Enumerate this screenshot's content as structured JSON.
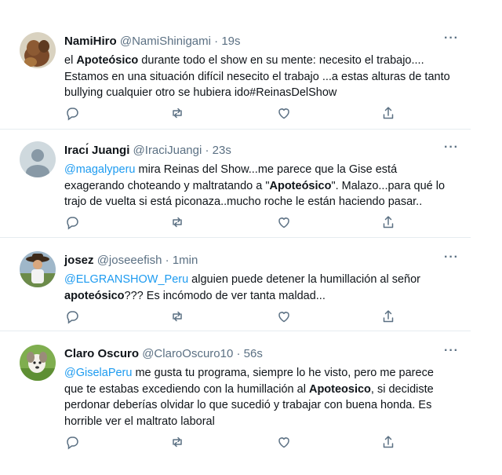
{
  "tweets": [
    {
      "name": "NamiHiro",
      "handle": "@NamiShinigami",
      "dot": "·",
      "time": "19s",
      "more": "···",
      "lines": [
        [
          {
            "t": "el "
          },
          {
            "t": "Apoteósico",
            "s": "strong"
          },
          {
            "t": " durante todo el show en su mente: necesito el trabajo...."
          }
        ],
        [
          {
            "t": "Estamos en una situación difícil nesecito el trabajo ...a estas alturas de tanto"
          }
        ],
        [
          {
            "t": "bullying cualquier otro se hubiera ido#ReinasDelShow"
          }
        ]
      ],
      "avatar": "avatar-dog-photo"
    },
    {
      "name": "Iracı́ Juangi",
      "handle": "@IraciJuangi",
      "dot": "·",
      "time": "23s",
      "more": "···",
      "lines": [
        [
          {
            "t": "@magalyperu",
            "s": "mention"
          },
          {
            "t": " mira Reinas del Show...me parece que la Gise está"
          }
        ],
        [
          {
            "t": "exagerando choteando y maltratando a \""
          },
          {
            "t": "Apoteósico",
            "s": "strong"
          },
          {
            "t": "\". Malazo...para qué lo"
          }
        ],
        [
          {
            "t": "trajo de vuelta si está piconaza..mucho roche le están haciendo pasar.."
          }
        ]
      ],
      "avatar": "default-avatar"
    },
    {
      "name": "josez",
      "handle": "@joseeefish",
      "dot": "·",
      "time": "1min",
      "more": "···",
      "lines": [
        [
          {
            "t": "@ELGRANSHOW_Peru",
            "s": "mention"
          },
          {
            "t": " alguien puede detener la humillación al señor"
          }
        ],
        [
          {
            "t": "apoteósico",
            "s": "strong"
          },
          {
            "t": "???  Es incómodo de ver tanta maldad..."
          }
        ]
      ],
      "avatar": "avatar-person-hat"
    },
    {
      "name": "Claro Oscuro",
      "handle": "@ClaroOscuro10",
      "dot": "·",
      "time": "56s",
      "more": "···",
      "lines": [
        [
          {
            "t": "@GiselaPeru",
            "s": "mention"
          },
          {
            "t": " me gusta tu programa, siempre lo he visto, pero me parece"
          }
        ],
        [
          {
            "t": "que te estabas excediendo con la humillación al "
          },
          {
            "t": "Apoteosico",
            "s": "strong"
          },
          {
            "t": ", si decidiste"
          }
        ],
        [
          {
            "t": "perdonar deberías olvidar lo que sucedió y trabajar con buena honda. Es"
          }
        ],
        [
          {
            "t": "horrible ver el maltrato laboral"
          }
        ]
      ],
      "avatar": "avatar-dog-grass"
    }
  ],
  "colors": {
    "link": "#1d9bf0",
    "secondary": "#5b7083",
    "divider": "#e6ecf0"
  },
  "icons": [
    "reply-icon",
    "retweet-icon",
    "like-icon",
    "share-icon",
    "more-icon"
  ]
}
